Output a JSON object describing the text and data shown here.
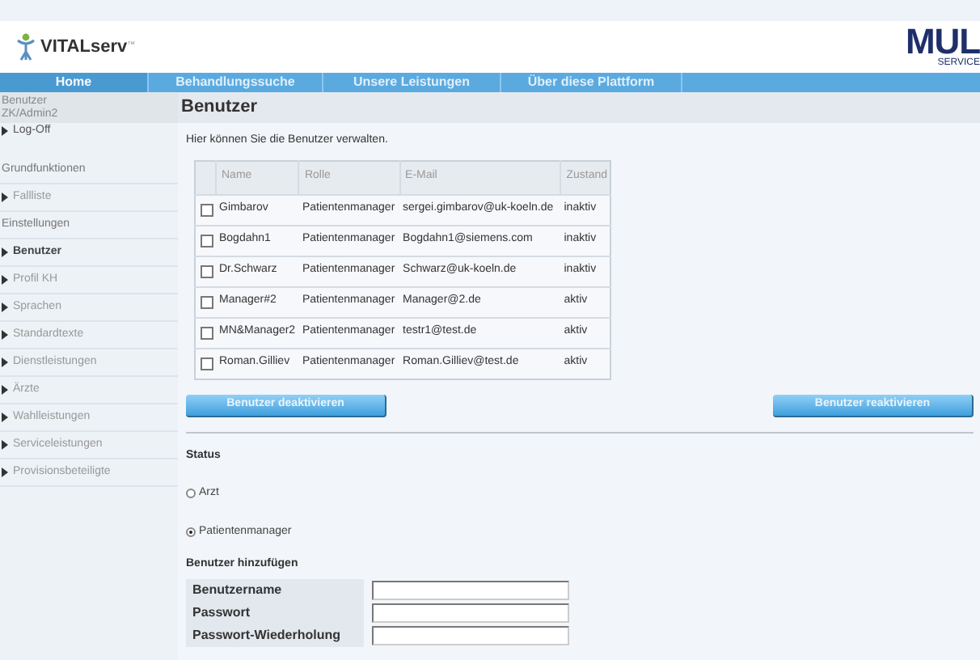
{
  "header": {
    "logo": "VITALserv",
    "logo_mark": "™",
    "partner_logo": "MUL",
    "partner_sub": "SERVICE"
  },
  "nav": [
    {
      "label": "Home",
      "selected": true
    },
    {
      "label": "Behandlungssuche",
      "selected": false
    },
    {
      "label": "Unsere Leistungen",
      "selected": false
    },
    {
      "label": "Über diese Plattform",
      "selected": false
    }
  ],
  "user": {
    "label": "Benutzer",
    "name": "ZK/Admin2",
    "logoff": "Log-Off"
  },
  "sidebar": [
    {
      "kind": "heading",
      "label": "Grundfunktionen"
    },
    {
      "kind": "link",
      "label": "Fallliste",
      "selected": false
    },
    {
      "kind": "heading",
      "label": "Einstellungen"
    },
    {
      "kind": "link",
      "label": "Benutzer",
      "selected": true
    },
    {
      "kind": "link",
      "label": "Profil KH",
      "selected": false
    },
    {
      "kind": "link",
      "label": "Sprachen",
      "selected": false
    },
    {
      "kind": "link",
      "label": "Standardtexte",
      "selected": false
    },
    {
      "kind": "link",
      "label": "Dienstleistungen",
      "selected": false
    },
    {
      "kind": "link",
      "label": "Ärzte",
      "selected": false
    },
    {
      "kind": "link",
      "label": "Wahlleistungen",
      "selected": false
    },
    {
      "kind": "link",
      "label": "Serviceleistungen",
      "selected": false
    },
    {
      "kind": "link",
      "label": "Provisionsbeteiligte",
      "selected": false
    }
  ],
  "page": {
    "title": "Benutzer",
    "intro": "Hier können Sie die Benutzer verwalten."
  },
  "table": {
    "columns": [
      "Name",
      "Rolle",
      "E-Mail",
      "Zustand"
    ],
    "rows": [
      {
        "checked": false,
        "cells": [
          "Gimbarov",
          "Patientenmanager",
          "sergei.gimbarov@uk-koeln.de",
          "inaktiv"
        ]
      },
      {
        "checked": false,
        "cells": [
          "Bogdahn1",
          "Patientenmanager",
          "Bogdahn1@siemens.com",
          "inaktiv"
        ]
      },
      {
        "checked": false,
        "cells": [
          "Dr.Schwarz",
          "Patientenmanager",
          "Schwarz@uk-koeln.de",
          "inaktiv"
        ]
      },
      {
        "checked": false,
        "cells": [
          "Manager#2",
          "Patientenmanager",
          "Manager@2.de",
          "aktiv"
        ]
      },
      {
        "checked": false,
        "cells": [
          "MN&Manager2",
          "Patientenmanager",
          "testr1@test.de",
          "aktiv"
        ]
      },
      {
        "checked": false,
        "cells": [
          "Roman.Gilliev",
          "Patientenmanager",
          "Roman.Gilliev@test.de",
          "aktiv"
        ]
      }
    ]
  },
  "buttons": [
    "Benutzer deaktivieren",
    "Benutzer reaktivieren"
  ],
  "status": {
    "label": "Status",
    "options": [
      {
        "label": "Arzt",
        "selected": false
      },
      {
        "label": "Patientenmanager",
        "selected": true
      }
    ]
  },
  "add_user": {
    "title": "Benutzer hinzufügen",
    "fields": [
      {
        "label": "Benutzername"
      },
      {
        "label": "Passwort"
      },
      {
        "label": "Passwort-Wiederholung"
      }
    ]
  }
}
